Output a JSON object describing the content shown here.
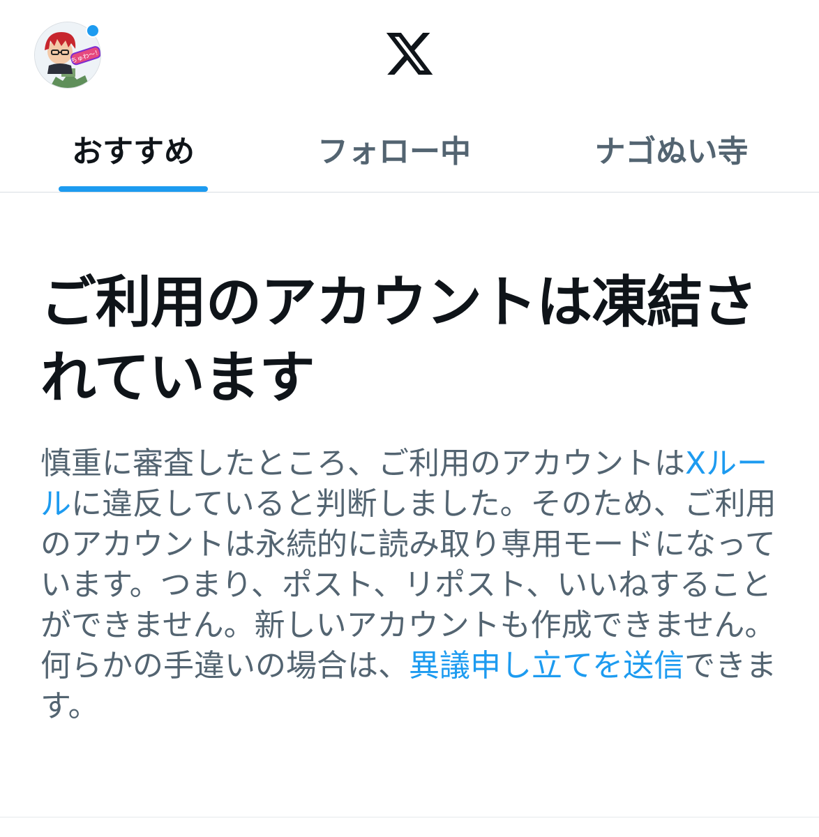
{
  "header": {
    "avatar_icon": "profile-avatar",
    "notification_dot_color": "#1d9bf0",
    "logo_icon": "x-logo-icon",
    "avatar_badge_text": "ちゅわ〜！"
  },
  "tabs": [
    {
      "label": "おすすめ",
      "active": true
    },
    {
      "label": "フォロー中",
      "active": false
    },
    {
      "label": "ナゴぬい寺",
      "active": false
    }
  ],
  "notice": {
    "title": "ご利用のアカウントは凍結されています",
    "body_part1": "慎重に審査したところ、ご利用のアカウントは",
    "rules_link": "Xルール",
    "body_part2": "に違反していると判断しました。そのため、ご利用のアカウントは永続的に読み取り専用モードになっています。つまり、ポスト、リポスト、いいねすることができません。新しいアカウントも作成できません。何らかの手違いの場合は、",
    "appeal_link": "異議申し立てを送信",
    "body_part3": "できます。"
  },
  "colors": {
    "accent": "#1d9bf0",
    "text_primary": "#0f1419",
    "text_secondary": "#536471"
  }
}
